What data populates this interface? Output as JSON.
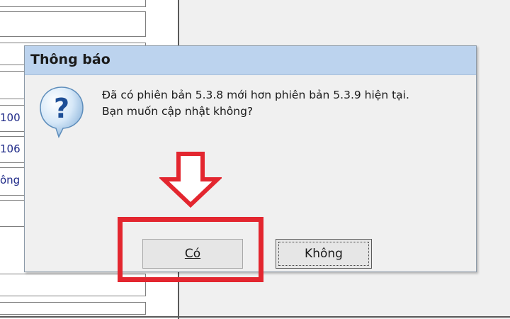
{
  "background": {
    "row_texts": [
      "100",
      "106",
      "ông"
    ]
  },
  "dialog": {
    "title": "Thông báo",
    "icon": "question-icon",
    "message_line1": "Đã có phiên bản 5.3.8 mới hơn phiên bản 5.3.9 hiện tại.",
    "message_line2": "Bạn muốn cập nhật không?",
    "yes_label": "Có",
    "no_label": "Không"
  },
  "annotation": {
    "color": "#e3262f",
    "shapes": [
      "down-arrow",
      "highlight-box"
    ]
  }
}
